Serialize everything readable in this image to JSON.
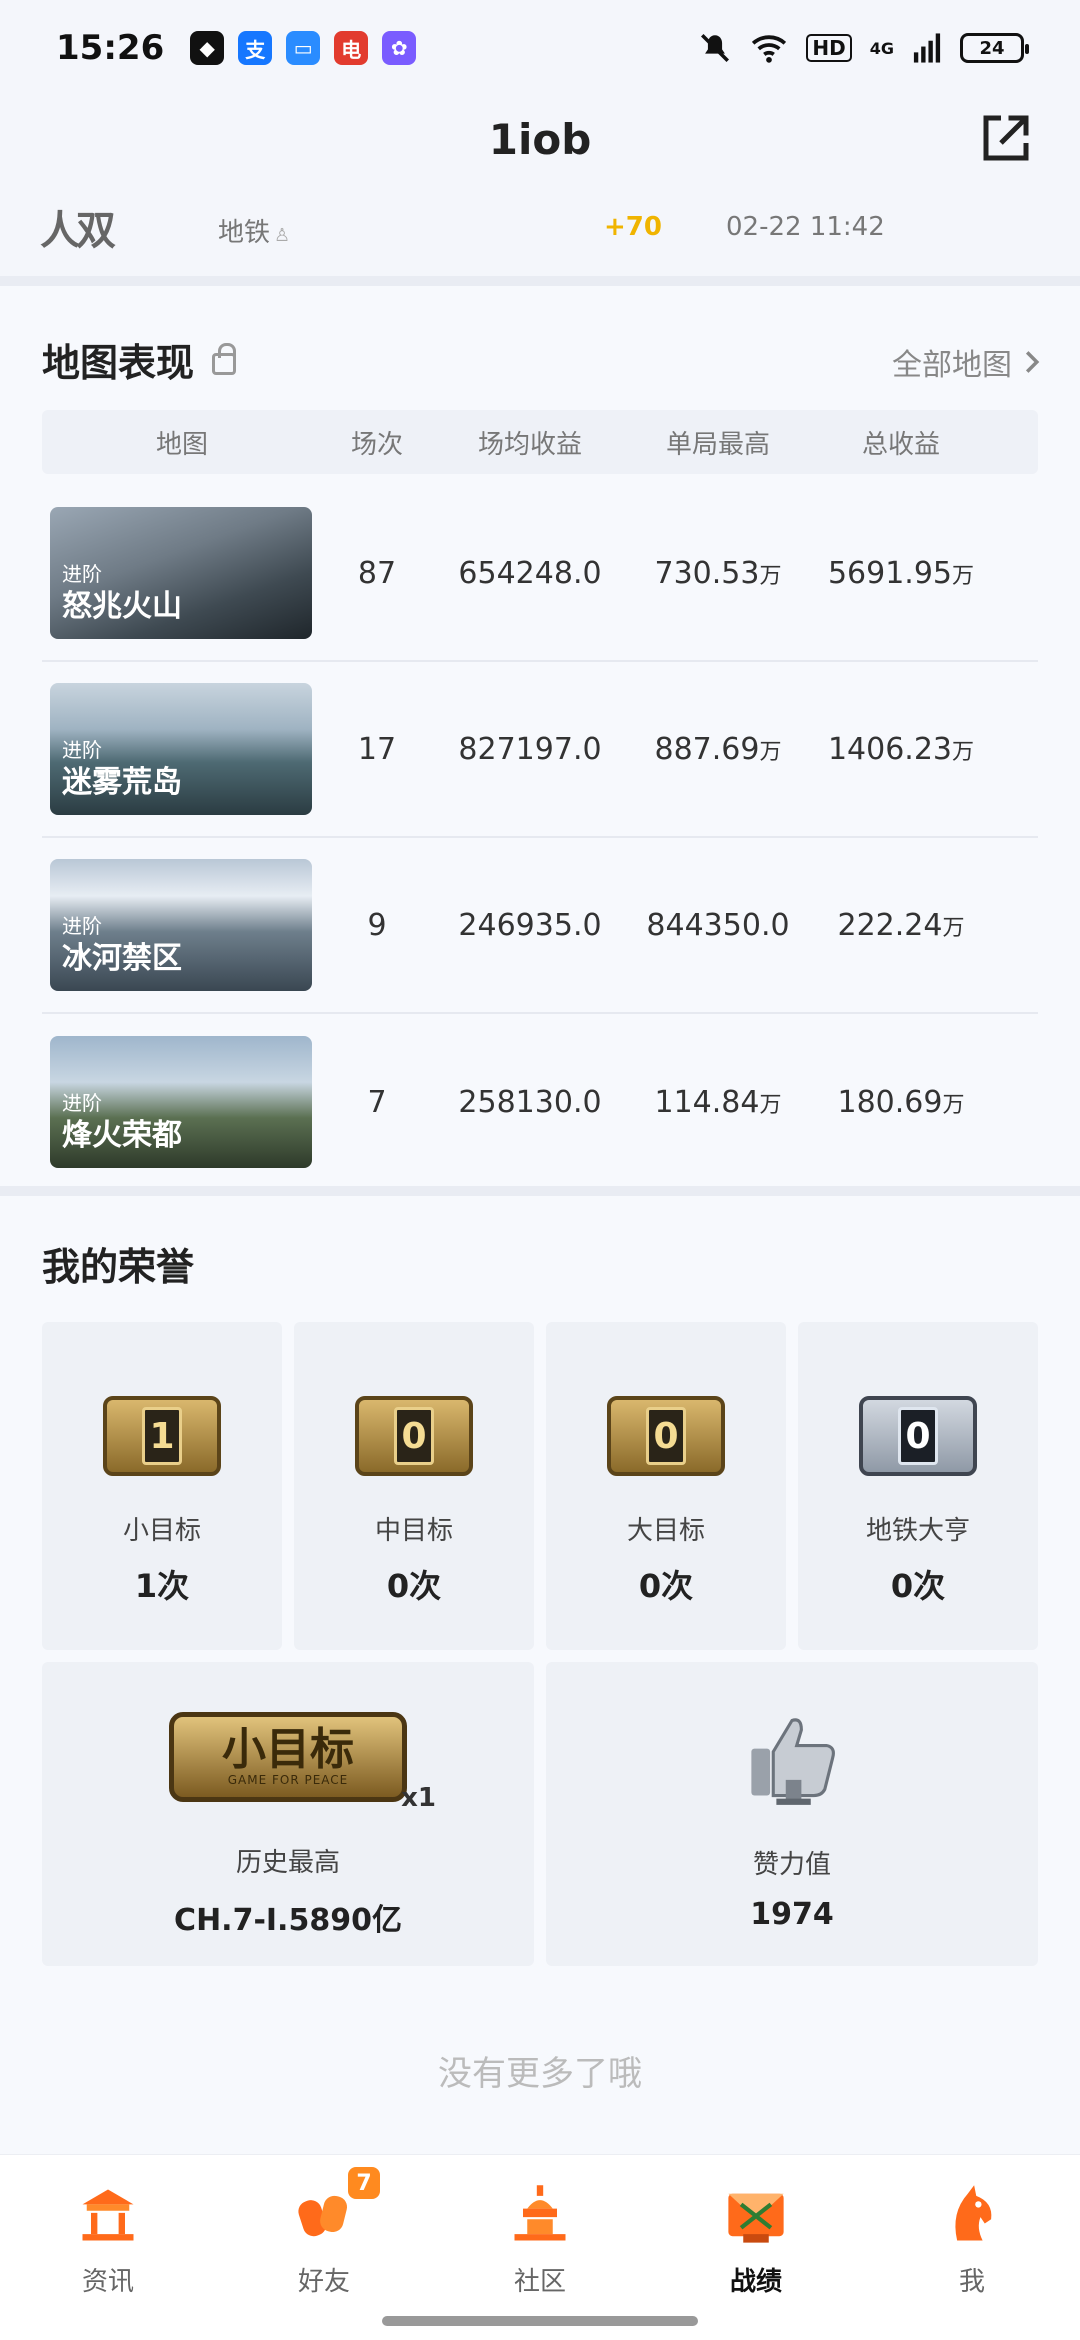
{
  "status_bar": {
    "time": "15:26",
    "apps": [
      {
        "icon": "shield-app-icon",
        "color": "#111111",
        "glyph": "◆"
      },
      {
        "icon": "alipay-app-icon",
        "color": "#1677ff",
        "glyph": "支"
      },
      {
        "icon": "files-app-icon",
        "color": "#2a8cff",
        "glyph": "▭"
      },
      {
        "icon": "telecom-app-icon",
        "color": "#e23b2e",
        "glyph": "电"
      },
      {
        "icon": "gallery-app-icon",
        "color": "#7a5cff",
        "glyph": "✿"
      }
    ],
    "hd": "HD",
    "network": "4G",
    "battery": "24"
  },
  "header": {
    "title": "1iob"
  },
  "prev_row": {
    "partial_name": "人双",
    "mode": "地铁",
    "gain": "+70",
    "time": "02-22 11:42"
  },
  "map_section": {
    "title": "地图表现",
    "all_maps_label": "全部地图",
    "columns": [
      "地图",
      "场次",
      "场均收益",
      "单局最高",
      "总收益"
    ],
    "rows": [
      {
        "tier": "进阶",
        "name": "怒兆火山",
        "matches": "87",
        "avg": "654248.0",
        "max": "730.53",
        "max_unit": "万",
        "total": "5691.95",
        "total_unit": "万"
      },
      {
        "tier": "进阶",
        "name": "迷雾荒岛",
        "matches": "17",
        "avg": "827197.0",
        "max": "887.69",
        "max_unit": "万",
        "total": "1406.23",
        "total_unit": "万"
      },
      {
        "tier": "进阶",
        "name": "冰河禁区",
        "matches": "9",
        "avg": "246935.0",
        "max": "844350.0",
        "max_unit": "",
        "total": "222.24",
        "total_unit": "万"
      },
      {
        "tier": "进阶",
        "name": "烽火荣都",
        "matches": "7",
        "avg": "258130.0",
        "max": "114.84",
        "max_unit": "万",
        "total": "180.69",
        "total_unit": "万"
      }
    ]
  },
  "honor_section": {
    "title": "我的荣誉",
    "cards": [
      {
        "badge_number": "1",
        "label": "小目标",
        "count": "1次",
        "style": "gold"
      },
      {
        "badge_number": "0",
        "label": "中目标",
        "count": "0次",
        "style": "gold"
      },
      {
        "badge_number": "0",
        "label": "大目标",
        "count": "0次",
        "style": "gold"
      },
      {
        "badge_number": "0",
        "label": "地铁大亨",
        "count": "0次",
        "style": "silver"
      }
    ],
    "history_badge_title": "小目标",
    "history_badge_sub": "GAME FOR PEACE",
    "history_badge_multiplier": "x1",
    "history_label": "历史最高",
    "history_value": "CH.7-I.5890亿",
    "likes_label": "赞力值",
    "likes_value": "1974"
  },
  "footer_text": "没有更多了哦",
  "bottom_nav": {
    "items": [
      {
        "label": "资讯",
        "icon": "news-icon"
      },
      {
        "label": "好友",
        "icon": "friends-icon",
        "badge": "7"
      },
      {
        "label": "社区",
        "icon": "community-icon"
      },
      {
        "label": "战绩",
        "icon": "records-icon",
        "active": true
      },
      {
        "label": "我",
        "icon": "profile-icon"
      }
    ]
  }
}
